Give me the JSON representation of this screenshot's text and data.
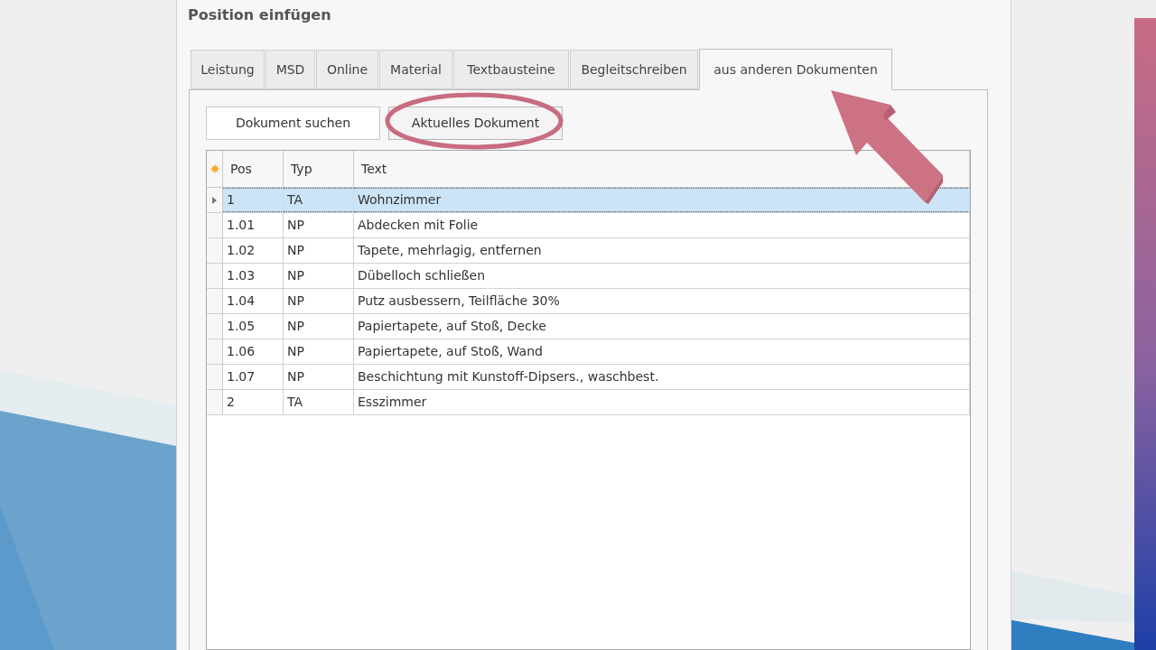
{
  "dialog": {
    "title": "Position einfügen"
  },
  "tabs": [
    {
      "label": "Leistung",
      "selected": false
    },
    {
      "label": "MSD",
      "selected": false
    },
    {
      "label": "Online",
      "selected": false
    },
    {
      "label": "Material",
      "selected": false
    },
    {
      "label": "Textbausteine",
      "selected": false
    },
    {
      "label": "Begleitschreiben",
      "selected": false
    },
    {
      "label": "aus anderen Dokumenten",
      "selected": true
    }
  ],
  "buttons": [
    {
      "label": "Dokument suchen",
      "highlighted": false
    },
    {
      "label": "Aktuelles Dokument",
      "highlighted": true
    }
  ],
  "table": {
    "columns": [
      "Pos",
      "Typ",
      "Text"
    ],
    "rows": [
      {
        "cells": [
          "1",
          "TA",
          "Wohnzimmer"
        ],
        "selected": true
      },
      {
        "cells": [
          "1.01",
          "NP",
          "Abdecken mit Folie"
        ],
        "selected": false
      },
      {
        "cells": [
          "1.02",
          "NP",
          "Tapete, mehrlagig, entfernen"
        ],
        "selected": false
      },
      {
        "cells": [
          "1.03",
          "NP",
          "Dübelloch schließen"
        ],
        "selected": false
      },
      {
        "cells": [
          "1.04",
          "NP",
          "Putz ausbessern, Teilfläche 30%"
        ],
        "selected": false
      },
      {
        "cells": [
          "1.05",
          "NP",
          "Papiertapete, auf Stoß, Decke"
        ],
        "selected": false
      },
      {
        "cells": [
          "1.06",
          "NP",
          "Papiertapete, auf Stoß, Wand"
        ],
        "selected": false
      },
      {
        "cells": [
          "1.07",
          "NP",
          "Beschichtung mit Kunstoff-Dipsers., waschbest."
        ],
        "selected": false
      },
      {
        "cells": [
          "2",
          "TA",
          "Esszimmer"
        ],
        "selected": false
      }
    ]
  }
}
